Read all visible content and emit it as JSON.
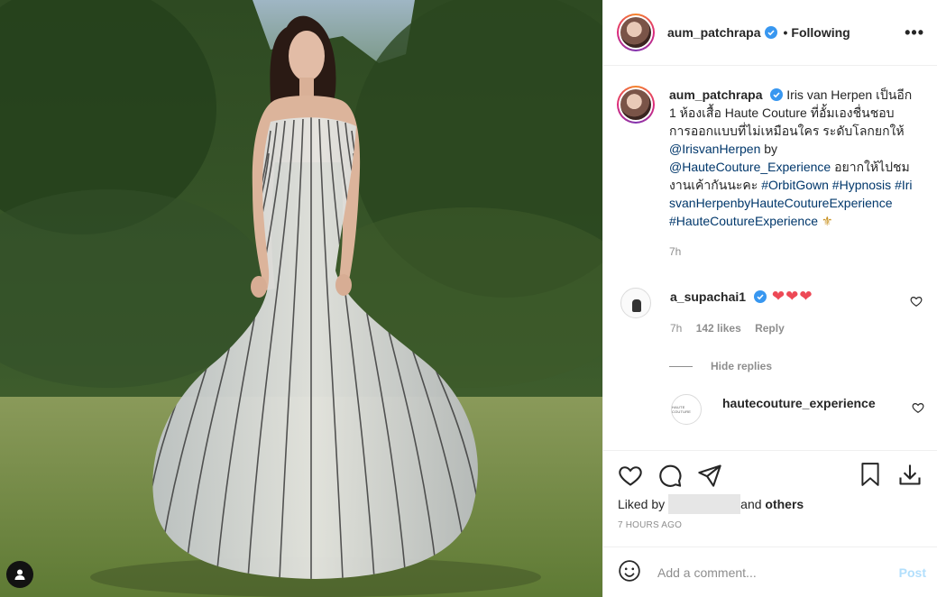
{
  "header": {
    "username": "aum_patchrapa",
    "separator": "•",
    "follow_status": "Following",
    "more_label": "•••"
  },
  "caption": {
    "username": "aum_patchrapa",
    "text_1": "Iris van Herpen เป็นอีก 1 ห้องเสื้อ Haute Couture ที่อั้มเองชื่นชอบการออกแบบที่ไม่เหมือนใคร ระดับโลกยกให้ ",
    "mention_1": "@IrisvanHerpen",
    "text_2": " by ",
    "mention_2": "@HauteCouture_Experience",
    "text_3": " อยากให้ไปชมงานเค้ากันนะคะ ",
    "hashtag_1": "#OrbitGown",
    "hashtag_2": "#Hypnosis",
    "hashtag_3": "#IrisvanHerpenbyHauteCoutureExperience",
    "hashtag_4": "#HauteCoutureExperience",
    "emoji": "⚜",
    "time": "7h"
  },
  "comment": {
    "username": "a_supachai1",
    "text": "❤❤❤",
    "time": "7h",
    "likes": "142 likes",
    "reply_label": "Reply"
  },
  "hide_replies_label": "Hide replies",
  "reply": {
    "username": "hautecouture_experience",
    "avatar_text": "HAUTE COUTURE"
  },
  "liked_by": {
    "prefix": "Liked by",
    "suffix": "and",
    "others": "others"
  },
  "posted_time": "7 HOURS AGO",
  "add_comment": {
    "placeholder": "Add a comment...",
    "post_label": "Post"
  },
  "colors": {
    "link": "#00376b",
    "secondary_text": "#8e8e8e",
    "verified": "#3897f0",
    "post_button": "#b2dffc",
    "heart_red": "#ed4956"
  }
}
